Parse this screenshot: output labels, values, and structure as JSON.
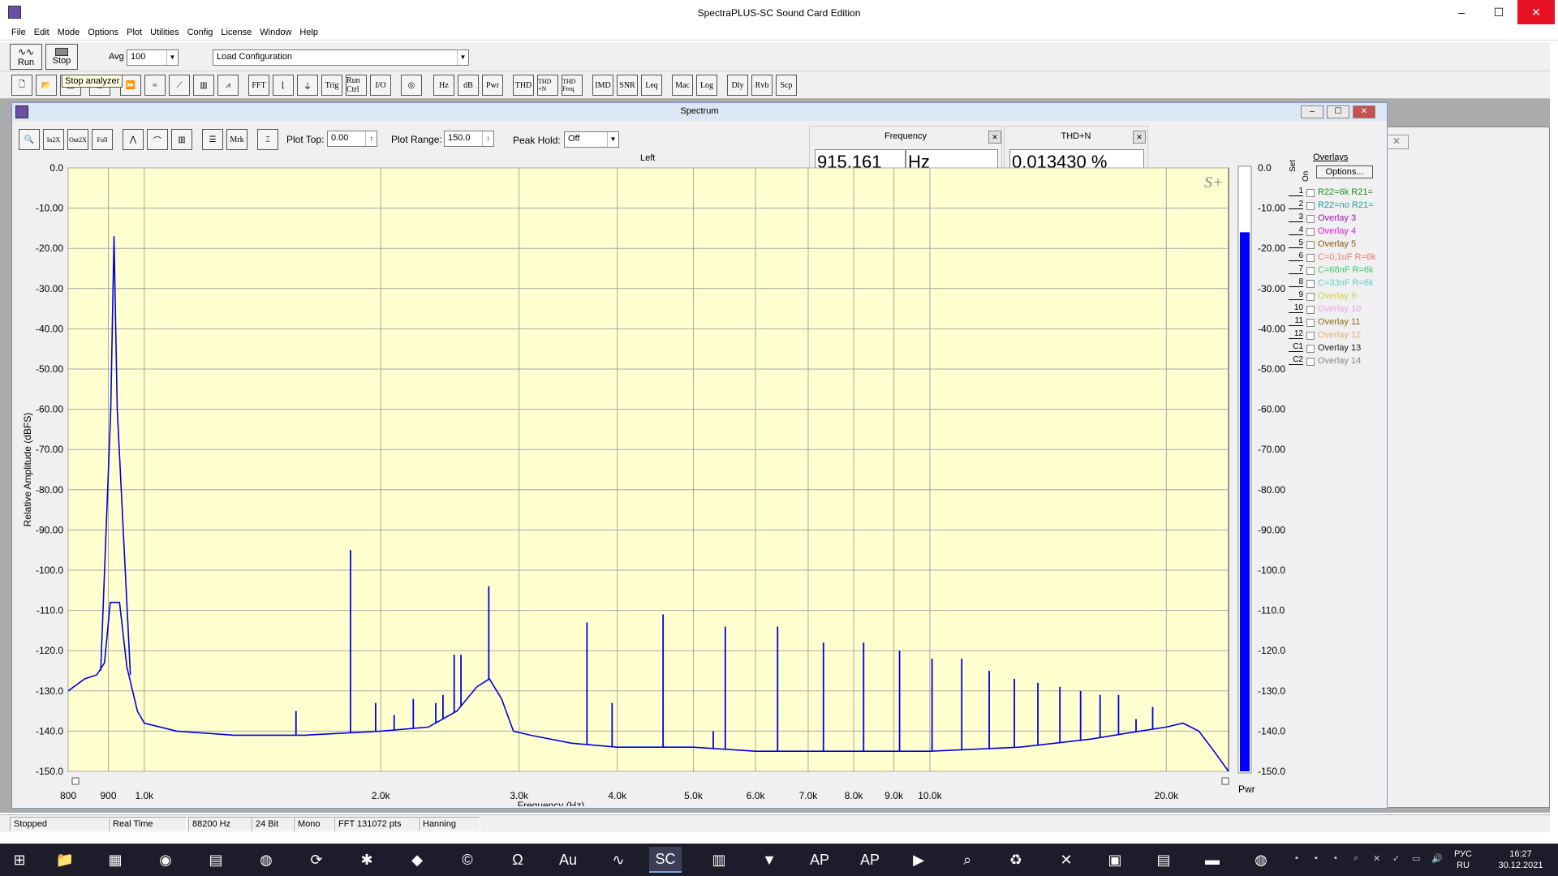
{
  "app": {
    "title": "SpectraPLUS-SC Sound Card Edition",
    "window_controls": {
      "minimize": "–",
      "maximize": "☐",
      "close": "✕"
    }
  },
  "menu": [
    "File",
    "Edit",
    "Mode",
    "Options",
    "Plot",
    "Utilities",
    "Config",
    "License",
    "Window",
    "Help"
  ],
  "toolbar": {
    "run_label": "Run",
    "stop_label": "Stop",
    "avg_label": "Avg",
    "avg_value": "100",
    "config_value": "Load Configuration",
    "tooltip": "Stop analyzer",
    "buttons": [
      "FFT",
      "Trig",
      "Run Ctrl",
      "I/O",
      "Hz",
      "dB",
      "Pwr",
      "THD",
      "THD +N",
      "THD Freq",
      "IMD",
      "SNR",
      "Leq",
      "Mac",
      "Log",
      "Dly",
      "Rvb",
      "Scp"
    ]
  },
  "spectrum_window": {
    "title": "Spectrum",
    "controls": {
      "mrk_label": "Mrk",
      "plot_top_label": "Plot Top:",
      "plot_top_value": "0.00",
      "plot_range_label": "Plot Range:",
      "plot_range_value": "150.0",
      "peak_hold_label": "Peak Hold:",
      "peak_hold_value": "Off"
    },
    "frequency_readout": {
      "title": "Frequency",
      "value": "915.161",
      "unit": "Hz"
    },
    "thdn_readout": {
      "title": "THD+N",
      "value": "0.013430 %"
    },
    "channel_label": "Left",
    "logo": "S+",
    "pwr_label": "Pwr"
  },
  "overlays": {
    "title": "Overlays",
    "options_label": "Options...",
    "set_label": "Set",
    "on_label": "On",
    "items": [
      {
        "num": "1",
        "label": "R22=6k R21=",
        "color": "#1a8f1a"
      },
      {
        "num": "2",
        "label": "R22=no R21=",
        "color": "#1aa3a3"
      },
      {
        "num": "3",
        "label": "Overlay 3",
        "color": "#9a1ab0"
      },
      {
        "num": "4",
        "label": "Overlay 4",
        "color": "#e01ae0"
      },
      {
        "num": "5",
        "label": "Overlay 5",
        "color": "#8a5a10"
      },
      {
        "num": "6",
        "label": "C=0,1uF R=6k",
        "color": "#ee7777"
      },
      {
        "num": "7",
        "label": "C=68nF R=6k",
        "color": "#33cc66"
      },
      {
        "num": "8",
        "label": "C=33nF R=6k",
        "color": "#66cccc"
      },
      {
        "num": "9",
        "label": "Overlay 9",
        "color": "#d8d040"
      },
      {
        "num": "10",
        "label": "Overlay 10",
        "color": "#f0a0f0"
      },
      {
        "num": "11",
        "label": "Overlay 11",
        "color": "#8a7010"
      },
      {
        "num": "12",
        "label": "Overlay 12",
        "color": "#e0b080"
      },
      {
        "num": "C1",
        "label": "Overlay 13",
        "color": "#222222"
      },
      {
        "num": "C2",
        "label": "Overlay 14",
        "color": "#888888"
      }
    ]
  },
  "status": [
    "Stopped",
    "Real Time",
    "88200 Hz",
    "24 Bit",
    "Mono",
    "FFT 131072 pts",
    "Hanning"
  ],
  "taskbar": {
    "lang_top": "РУС",
    "lang_bottom": "RU",
    "time": "16:27",
    "date": "30.12.2021"
  },
  "chart_data": {
    "type": "line",
    "title": "",
    "xlabel": "Frequency (Hz)",
    "ylabel": "Relative Amplitude (dBFS)",
    "x_scale": "log",
    "xlim": [
      800,
      24000
    ],
    "ylim": [
      -150,
      0
    ],
    "x_ticks": [
      "800",
      "900",
      "1.0k",
      "2.0k",
      "3.0k",
      "4.0k",
      "5.0k",
      "6.0k",
      "7.0k",
      "8.0k",
      "9.0k",
      "10.0k",
      "20.0k"
    ],
    "x_tick_values": [
      800,
      900,
      1000,
      2000,
      3000,
      4000,
      5000,
      6000,
      7000,
      8000,
      9000,
      10000,
      20000
    ],
    "y_ticks": [
      "0.0",
      "-10.00",
      "-20.00",
      "-30.00",
      "-40.00",
      "-50.00",
      "-60.00",
      "-70.00",
      "-80.00",
      "-90.00",
      "-100.0",
      "-110.0",
      "-120.0",
      "-130.0",
      "-140.0",
      "-150.0"
    ],
    "y_tick_values": [
      0,
      -10,
      -20,
      -30,
      -40,
      -50,
      -60,
      -70,
      -80,
      -90,
      -100,
      -110,
      -120,
      -130,
      -140,
      -150
    ],
    "grid": true,
    "background": "#ffffd0",
    "line_color": "#0000e0",
    "fundamental": {
      "x": 915,
      "y": -17
    },
    "noise_floor": [
      [
        800,
        -130
      ],
      [
        840,
        -127
      ],
      [
        870,
        -126
      ],
      [
        890,
        -123
      ],
      [
        905,
        -108
      ],
      [
        930,
        -108
      ],
      [
        950,
        -124
      ],
      [
        980,
        -135
      ],
      [
        1000,
        -138
      ],
      [
        1100,
        -140
      ],
      [
        1300,
        -141
      ],
      [
        1600,
        -141
      ],
      [
        2000,
        -140
      ],
      [
        2300,
        -139
      ],
      [
        2500,
        -135
      ],
      [
        2650,
        -129
      ],
      [
        2750,
        -127
      ],
      [
        2850,
        -132
      ],
      [
        2950,
        -140
      ],
      [
        3100,
        -141
      ],
      [
        3500,
        -143
      ],
      [
        4000,
        -144
      ],
      [
        5000,
        -144
      ],
      [
        6000,
        -145
      ],
      [
        8000,
        -145
      ],
      [
        10000,
        -145
      ],
      [
        13000,
        -144
      ],
      [
        16000,
        -142
      ],
      [
        18500,
        -140
      ],
      [
        20000,
        -139
      ],
      [
        21000,
        -138
      ],
      [
        22000,
        -140
      ],
      [
        23000,
        -145
      ],
      [
        24000,
        -150
      ]
    ],
    "harmonics": [
      [
        1560,
        -135
      ],
      [
        1830,
        -95
      ],
      [
        1970,
        -133
      ],
      [
        2080,
        -136
      ],
      [
        2200,
        -132
      ],
      [
        2350,
        -133
      ],
      [
        2400,
        -131
      ],
      [
        2480,
        -121
      ],
      [
        2530,
        -121
      ],
      [
        2745,
        -104
      ],
      [
        3660,
        -113
      ],
      [
        3940,
        -133
      ],
      [
        4575,
        -111
      ],
      [
        5300,
        -140
      ],
      [
        5490,
        -114
      ],
      [
        6400,
        -114
      ],
      [
        7320,
        -118
      ],
      [
        8235,
        -118
      ],
      [
        9150,
        -120
      ],
      [
        10065,
        -122
      ],
      [
        10980,
        -122
      ],
      [
        11900,
        -125
      ],
      [
        12810,
        -127
      ],
      [
        13725,
        -128
      ],
      [
        14640,
        -129
      ],
      [
        15555,
        -130
      ],
      [
        16470,
        -131
      ],
      [
        17385,
        -131
      ],
      [
        18300,
        -137
      ],
      [
        19215,
        -134
      ]
    ]
  }
}
